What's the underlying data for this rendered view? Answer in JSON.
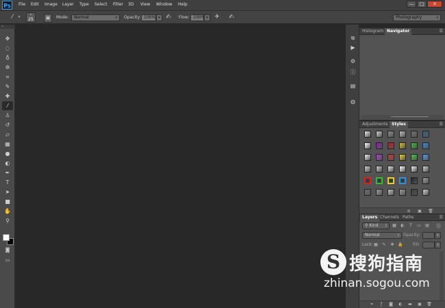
{
  "app": {
    "logo": "Ps"
  },
  "menubar": {
    "items": [
      "File",
      "Edit",
      "Image",
      "Layer",
      "Type",
      "Select",
      "Filter",
      "3D",
      "View",
      "Window",
      "Help"
    ]
  },
  "window_controls": {
    "minimize": "—",
    "maximize": "□",
    "close": "✕"
  },
  "options_bar": {
    "brush_size": "25",
    "mode_label": "Mode:",
    "mode_value": "Normal",
    "opacity_label": "Opacity:",
    "opacity_value": "100%",
    "flow_label": "Flow:",
    "flow_value": "100%",
    "workspace_value": "Photography"
  },
  "tools": [
    {
      "name": "move-tool",
      "glyph": "✥"
    },
    {
      "name": "marquee-tool",
      "glyph": "◌"
    },
    {
      "name": "lasso-tool",
      "glyph": "♁"
    },
    {
      "name": "quick-select-tool",
      "glyph": "✲"
    },
    {
      "name": "crop-tool",
      "glyph": "⌗"
    },
    {
      "name": "eyedropper-tool",
      "glyph": "✎"
    },
    {
      "name": "healing-brush-tool",
      "glyph": "✚"
    },
    {
      "name": "brush-tool",
      "glyph": "⁄"
    },
    {
      "name": "clone-stamp-tool",
      "glyph": "♙"
    },
    {
      "name": "history-brush-tool",
      "glyph": "↺"
    },
    {
      "name": "eraser-tool",
      "glyph": "▱"
    },
    {
      "name": "gradient-tool",
      "glyph": "▦"
    },
    {
      "name": "blur-tool",
      "glyph": "●"
    },
    {
      "name": "dodge-tool",
      "glyph": "◐"
    },
    {
      "name": "pen-tool",
      "glyph": "✒"
    },
    {
      "name": "type-tool",
      "glyph": "T"
    },
    {
      "name": "path-select-tool",
      "glyph": "➤"
    },
    {
      "name": "shape-tool",
      "glyph": "■"
    },
    {
      "name": "hand-tool",
      "glyph": "✋"
    },
    {
      "name": "zoom-tool",
      "glyph": "⚲"
    }
  ],
  "navigator_panel": {
    "tabs": [
      "Histogram",
      "Navigator"
    ],
    "active": "Navigator"
  },
  "styles_panel": {
    "tabs": [
      "Adjustments",
      "Styles"
    ],
    "active": "Styles"
  },
  "layers_panel": {
    "tabs": [
      "Layers",
      "Channels",
      "Paths"
    ],
    "active": "Layers",
    "kind_value": "Kind",
    "blend_value": "Normal",
    "opacity_label": "Opacity:",
    "lock_label": "Lock:",
    "fill_label": "Fill:"
  },
  "watermark": {
    "brand": "搜狗指南",
    "url": "zhinan.sogou.com",
    "logo": "S"
  },
  "style_swatch_colors": [
    [
      "#e8e8e8",
      "#cfcfcf",
      "#8c8c8c",
      "#bdbdbd",
      "#6f6f6f",
      "#3a5f80"
    ],
    [
      "#ffffff",
      "#8e1fb5",
      "#d11414",
      "#d4c21a",
      "#2fbf2f",
      "#2f8fdf"
    ],
    [
      "#f0f0f0",
      "#b03fd6",
      "#e03030",
      "#e6d020",
      "#3ad03a",
      "#4aa0ef"
    ],
    [
      "#d0d0d0",
      "#c8c8c8",
      "#dedede",
      "#ffffff",
      "#efefef",
      "#cfcfcf"
    ],
    [
      "#5a5a5a",
      "#3a3a3a",
      "#3a3a3a",
      "#3a3a3a",
      "#222222",
      "#9a9a9a"
    ],
    [
      "#6f6f6f",
      "#9a9a9a",
      "#bfbfbf",
      "#9a9a9a",
      "#3c3c3c",
      "#d0d0d0"
    ]
  ],
  "style_swatch_borders": [
    [
      "",
      "",
      "",
      "",
      "",
      ""
    ],
    [
      "",
      "",
      "",
      "",
      "",
      ""
    ],
    [
      "",
      "",
      "",
      "",
      "",
      ""
    ],
    [
      "",
      "",
      "",
      "",
      "",
      ""
    ],
    [
      "#e02020",
      "#2fbf2f",
      "#e6d020",
      "#2f8fdf",
      "",
      ""
    ],
    [
      "",
      "",
      "",
      "",
      "",
      ""
    ]
  ]
}
